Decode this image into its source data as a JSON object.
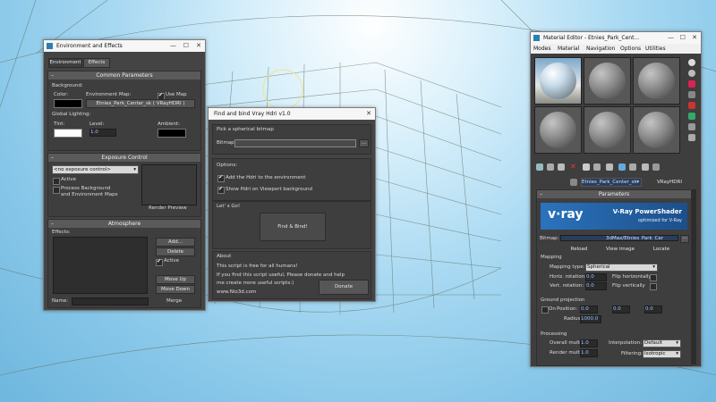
{
  "env_window": {
    "title": "Environment and Effects",
    "tabs": [
      "Environment",
      "Effects"
    ],
    "common_header": "Common Parameters",
    "background_label": "Background:",
    "color_label": "Color:",
    "env_map_label": "Environment Map:",
    "use_map_label": "Use Map",
    "env_map_value": "Etnies_Park_Center_sk  ( VRayHDRI )",
    "global_lighting_label": "Global Lighting:",
    "tint_label": "Tint:",
    "level_label": "Level:",
    "level_value": "1.0",
    "ambient_label": "Ambient:",
    "exposure_header": "Exposure Control",
    "exposure_select": "<no exposure control>",
    "active_label": "Active",
    "process_bg_label": "Process Background",
    "process_bg_label2": "and Environment Maps",
    "render_preview_label": "Render Preview",
    "atmosphere_header": "Atmosphere",
    "effects_label": "Effects:",
    "add_label": "Add...",
    "delete_label": "Delete",
    "atm_active_label": "Active",
    "move_up_label": "Move Up",
    "move_down_label": "Move Down",
    "name_label": "Name:",
    "merge_label": "Merge"
  },
  "find_window": {
    "title": "Find and bind Vray Hdri v1.0",
    "pick_header": "Pick a spherical bitmap",
    "bitmap_label": "Bitmap:",
    "browse_label": "...",
    "options_label": "Options:",
    "opt1": "Add the Hdri to the environment",
    "opt2": "Show Hdri on Viewport background",
    "letsgo_label": "Let' s Go!",
    "find_bind_label": "Find & Bind!",
    "about_label": "About",
    "about_line1": "This script is free for all humans!",
    "about_line2": "If you find this script useful, Please donate and help",
    "about_line3": "me create more useful scripts:)",
    "about_url": "www.Nio3d.com",
    "donate_label": "Donate"
  },
  "mat_window": {
    "title": "Material Editor - Etnies_Park_Cent...",
    "menu": [
      "Modes",
      "Material",
      "Navigation",
      "Options",
      "Utilities"
    ],
    "map_name": "Etnies_Park_Center_sk",
    "map_type": "VRayHDRI",
    "parameters_header": "Parameters",
    "vray_brand": "v·ray",
    "vray_title": "V-Ray PowerShader",
    "vray_subtitle": "optimized for V-Ray",
    "bitmap_label": "Bitmap:",
    "bitmap_path": "3dMax/Etnies_Park_Cer",
    "reload_label": "Reload",
    "viewimage_label": "View image",
    "locate_label": "Locate",
    "mapping_label": "Mapping",
    "mapping_type_label": "Mapping type:",
    "mapping_type_value": "Spherical",
    "horiz_rot_label": "Horiz. rotation:",
    "horiz_rot_value": "0.0",
    "flip_h_label": "Flip horizontally",
    "vert_rot_label": "Vert. rotation:",
    "vert_rot_value": "0.0",
    "flip_v_label": "Flip vertically",
    "ground_label": "Ground projection",
    "on_label": "On",
    "position_label": "Position:",
    "pos_x": "0.0",
    "pos_y": "0.0",
    "pos_z": "0.0",
    "radius_label": "Radius:",
    "radius_value": "1000.0",
    "processing_label": "Processing",
    "overall_label": "Overall mult:",
    "overall_value": "1.0",
    "interp_label": "Interpolation:",
    "interp_value": "Default",
    "render_mult_label": "Render mult:",
    "render_mult_value": "1.0",
    "filtering_label": "Filtering:",
    "filtering_value": "Isotropic"
  },
  "colors": {
    "panel": "#444444",
    "titlebar": "#f6f6f6",
    "vray_blue": "#1f5fa6",
    "sky": "#86c6e8"
  }
}
